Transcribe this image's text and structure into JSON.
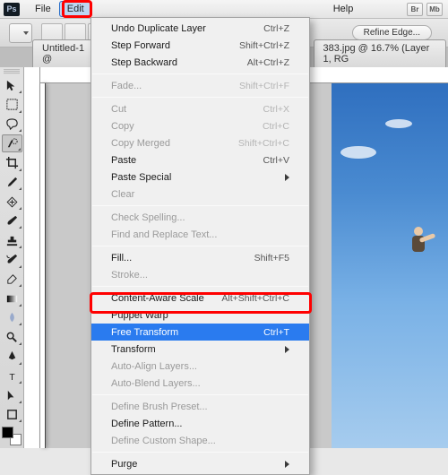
{
  "app": {
    "icon_text": "Ps"
  },
  "menubar": {
    "items": [
      "File",
      "Edit",
      "Help"
    ],
    "active_index": 1,
    "right_chips": [
      "Br",
      "Mb"
    ]
  },
  "optbar": {
    "refine_label": "Refine Edge..."
  },
  "tabs": {
    "left": {
      "label": "Untitled-1 @"
    },
    "right": {
      "label": "383.jpg @ 16.7% (Layer 1, RG"
    }
  },
  "edit_menu": {
    "groups": [
      [
        {
          "label": "Undo Duplicate Layer",
          "shortcut": "Ctrl+Z",
          "enabled": true
        },
        {
          "label": "Step Forward",
          "shortcut": "Shift+Ctrl+Z",
          "enabled": true
        },
        {
          "label": "Step Backward",
          "shortcut": "Alt+Ctrl+Z",
          "enabled": true
        }
      ],
      [
        {
          "label": "Fade...",
          "shortcut": "Shift+Ctrl+F",
          "enabled": false
        }
      ],
      [
        {
          "label": "Cut",
          "shortcut": "Ctrl+X",
          "enabled": false
        },
        {
          "label": "Copy",
          "shortcut": "Ctrl+C",
          "enabled": false
        },
        {
          "label": "Copy Merged",
          "shortcut": "Shift+Ctrl+C",
          "enabled": false
        },
        {
          "label": "Paste",
          "shortcut": "Ctrl+V",
          "enabled": true
        },
        {
          "label": "Paste Special",
          "submenu": true,
          "enabled": true
        },
        {
          "label": "Clear",
          "enabled": false
        }
      ],
      [
        {
          "label": "Check Spelling...",
          "enabled": false
        },
        {
          "label": "Find and Replace Text...",
          "enabled": false
        }
      ],
      [
        {
          "label": "Fill...",
          "shortcut": "Shift+F5",
          "enabled": true
        },
        {
          "label": "Stroke...",
          "enabled": false
        }
      ],
      [
        {
          "label": "Content-Aware Scale",
          "shortcut": "Alt+Shift+Ctrl+C",
          "enabled": true
        },
        {
          "label": "Puppet Warp",
          "enabled": true
        },
        {
          "label": "Free Transform",
          "shortcut": "Ctrl+T",
          "enabled": true,
          "highlighted": true
        },
        {
          "label": "Transform",
          "submenu": true,
          "enabled": true
        },
        {
          "label": "Auto-Align Layers...",
          "enabled": false
        },
        {
          "label": "Auto-Blend Layers...",
          "enabled": false
        }
      ],
      [
        {
          "label": "Define Brush Preset...",
          "enabled": false
        },
        {
          "label": "Define Pattern...",
          "enabled": true
        },
        {
          "label": "Define Custom Shape...",
          "enabled": false
        }
      ],
      [
        {
          "label": "Purge",
          "submenu": true,
          "enabled": true
        }
      ]
    ]
  },
  "highlight": {
    "menu_item": "Edit",
    "dropdown_item": "Free Transform"
  }
}
